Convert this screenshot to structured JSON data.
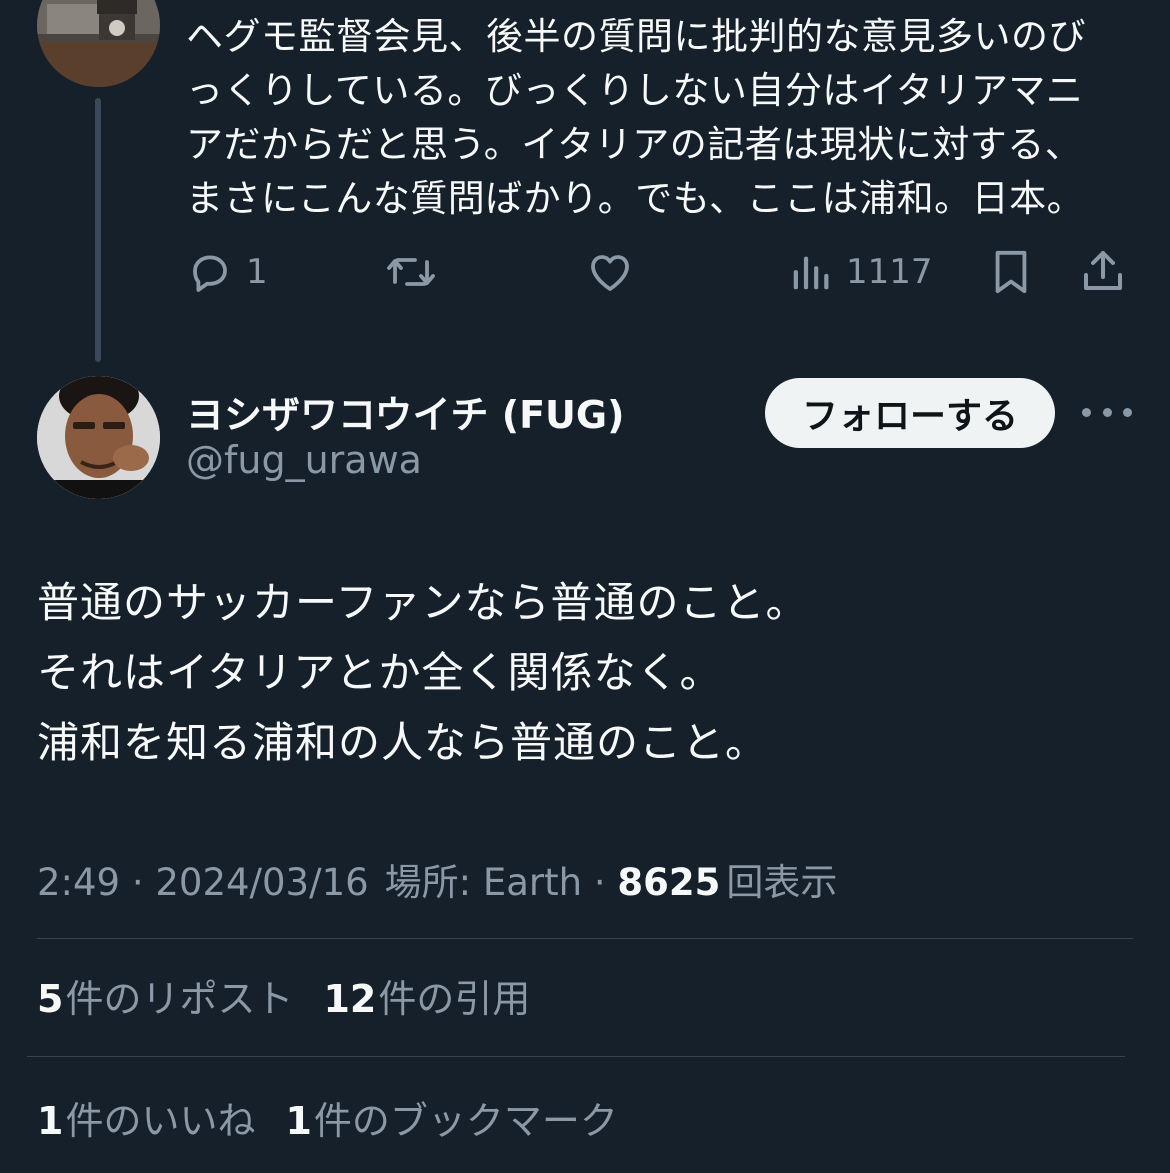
{
  "parent_tweet": {
    "text": "ヘグモ監督会見、後半の質問に批判的な意見多いのび\nっくりしている。びっくりしない自分はイタリアマニ\nアだからだと思う。イタリアの記者は現状に対する、\nまさにこんな質問ばかり。でも、ここは浦和。日本。",
    "reply_count": "1",
    "view_count": "1117",
    "icons": [
      "reply-icon",
      "retweet-icon",
      "like-icon",
      "analytics-icon",
      "bookmark-icon",
      "share-icon"
    ]
  },
  "main_tweet": {
    "display_name": "ヨシザワコウイチ (FUG)",
    "handle": "@fug_urawa",
    "follow_label": "フォローする",
    "body_lines": [
      "普通のサッカーファンなら普通のこと。",
      "それはイタリアとか全く関係なく。",
      "浦和を知る浦和の人なら普通のこと。"
    ],
    "time": "2:49",
    "date": "2024/03/16",
    "location": "場所: Earth",
    "separator": " · ",
    "views_count": "8625",
    "views_label": "回表示",
    "stats": {
      "reposts_count": "5",
      "reposts_label": "件のリポスト",
      "quotes_count": "12",
      "quotes_label": "件の引用",
      "likes_count": "1",
      "likes_label": "件のいいね",
      "bookmarks_count": "1",
      "bookmarks_label": "件のブックマーク"
    }
  },
  "colors": {
    "background": "#15202b",
    "text_primary": "#f7f9f9",
    "text_secondary": "#8b98a5",
    "divider": "#38444d",
    "follow_button_bg": "#eff3f4"
  }
}
